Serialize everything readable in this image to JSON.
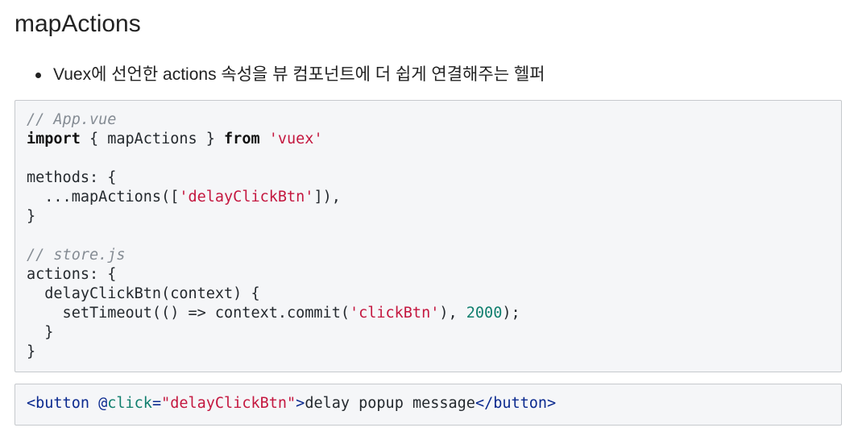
{
  "heading": "mapActions",
  "bullets": [
    "Vuex에 선언한 actions 속성을 뷰 컴포넌트에 더 쉽게 연결해주는 헬퍼"
  ],
  "code_main": {
    "comment_app": "// App.vue",
    "import_kw": "import",
    "import_mid": " { mapActions } ",
    "from_kw": "from",
    "import_sp": " ",
    "import_str": "'vuex'",
    "methods_open": "methods: {",
    "spread_pre": "  ...mapActions([",
    "spread_str": "'delayClickBtn'",
    "spread_post": "]),",
    "methods_close": "}",
    "comment_store": "// store.js",
    "actions_open": "actions: {",
    "fn_open": "  delayClickBtn(context) {",
    "timeout_pre": "    setTimeout(() => context.commit(",
    "timeout_str": "'clickBtn'",
    "timeout_mid": "), ",
    "timeout_num": "2000",
    "timeout_post": ");",
    "fn_close": "  }",
    "actions_close": "}"
  },
  "code_template": {
    "tag_open": "<button ",
    "at": "@",
    "event": "click",
    "eq": "=",
    "value": "\"delayClickBtn\"",
    "tag_close_open": ">",
    "text": "delay popup message",
    "tag_end": "</button>"
  },
  "colors": {
    "code_background": "#f5f6f8",
    "string": "#c4173f",
    "number": "#107f6e",
    "comment": "#858c94",
    "tag": "#0b2a8f"
  }
}
